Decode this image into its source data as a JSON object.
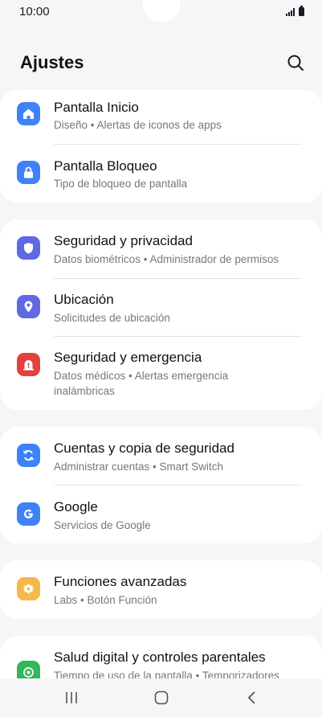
{
  "status": {
    "time": "10:00"
  },
  "header": {
    "title": "Ajustes"
  },
  "icons": {
    "search": "search-icon",
    "home": "home-icon",
    "lock": "lock-icon",
    "shield": "shield-icon",
    "location": "location-pin-icon",
    "emergency": "emergency-icon",
    "sync": "sync-icon",
    "google": "google-icon",
    "advanced": "advanced-features-icon",
    "wellbeing": "digital-wellbeing-icon"
  },
  "colors": {
    "background": "#f6f6f9",
    "card": "#ffffff",
    "home_icon": "#3e82f7",
    "lock_icon": "#3e82f7",
    "shield_icon": "#6068e3",
    "location_icon": "#6068e3",
    "emergency_icon": "#e2413d",
    "sync_icon": "#3e82f7",
    "google_icon": "#3e82f7",
    "advanced_icon": "#f7b84b",
    "wellbeing_icon": "#33b65c"
  },
  "settings": {
    "home_screen": {
      "label": "Pantalla Inicio",
      "sub": "Diseño  •  Alertas de iconos de apps"
    },
    "lock_screen": {
      "label": "Pantalla Bloqueo",
      "sub": "Tipo de bloqueo de pantalla"
    },
    "security": {
      "label": "Seguridad y privacidad",
      "sub": "Datos biométricos  •  Administrador de permisos"
    },
    "location": {
      "label": "Ubicación",
      "sub": "Solicitudes de ubicación"
    },
    "emergency": {
      "label": "Seguridad y emergencia",
      "sub1": "Datos médicos  •  Alertas emergencia",
      "sub2": "inalámbricas"
    },
    "accounts": {
      "label": "Cuentas y copia de seguridad",
      "sub": "Administrar cuentas  •  Smart Switch"
    },
    "google": {
      "label": "Google",
      "sub": "Servicios de Google"
    },
    "advanced": {
      "label": "Funciones avanzadas",
      "sub": "Labs  •  Botón Función"
    },
    "wellbeing": {
      "label": "Salud digital y controles parentales",
      "sub": "Tiempo de uso de la pantalla  •  Temporizadores"
    }
  },
  "nav": {
    "recents": "recents-icon",
    "home": "home-circle-icon",
    "back": "back-icon"
  }
}
